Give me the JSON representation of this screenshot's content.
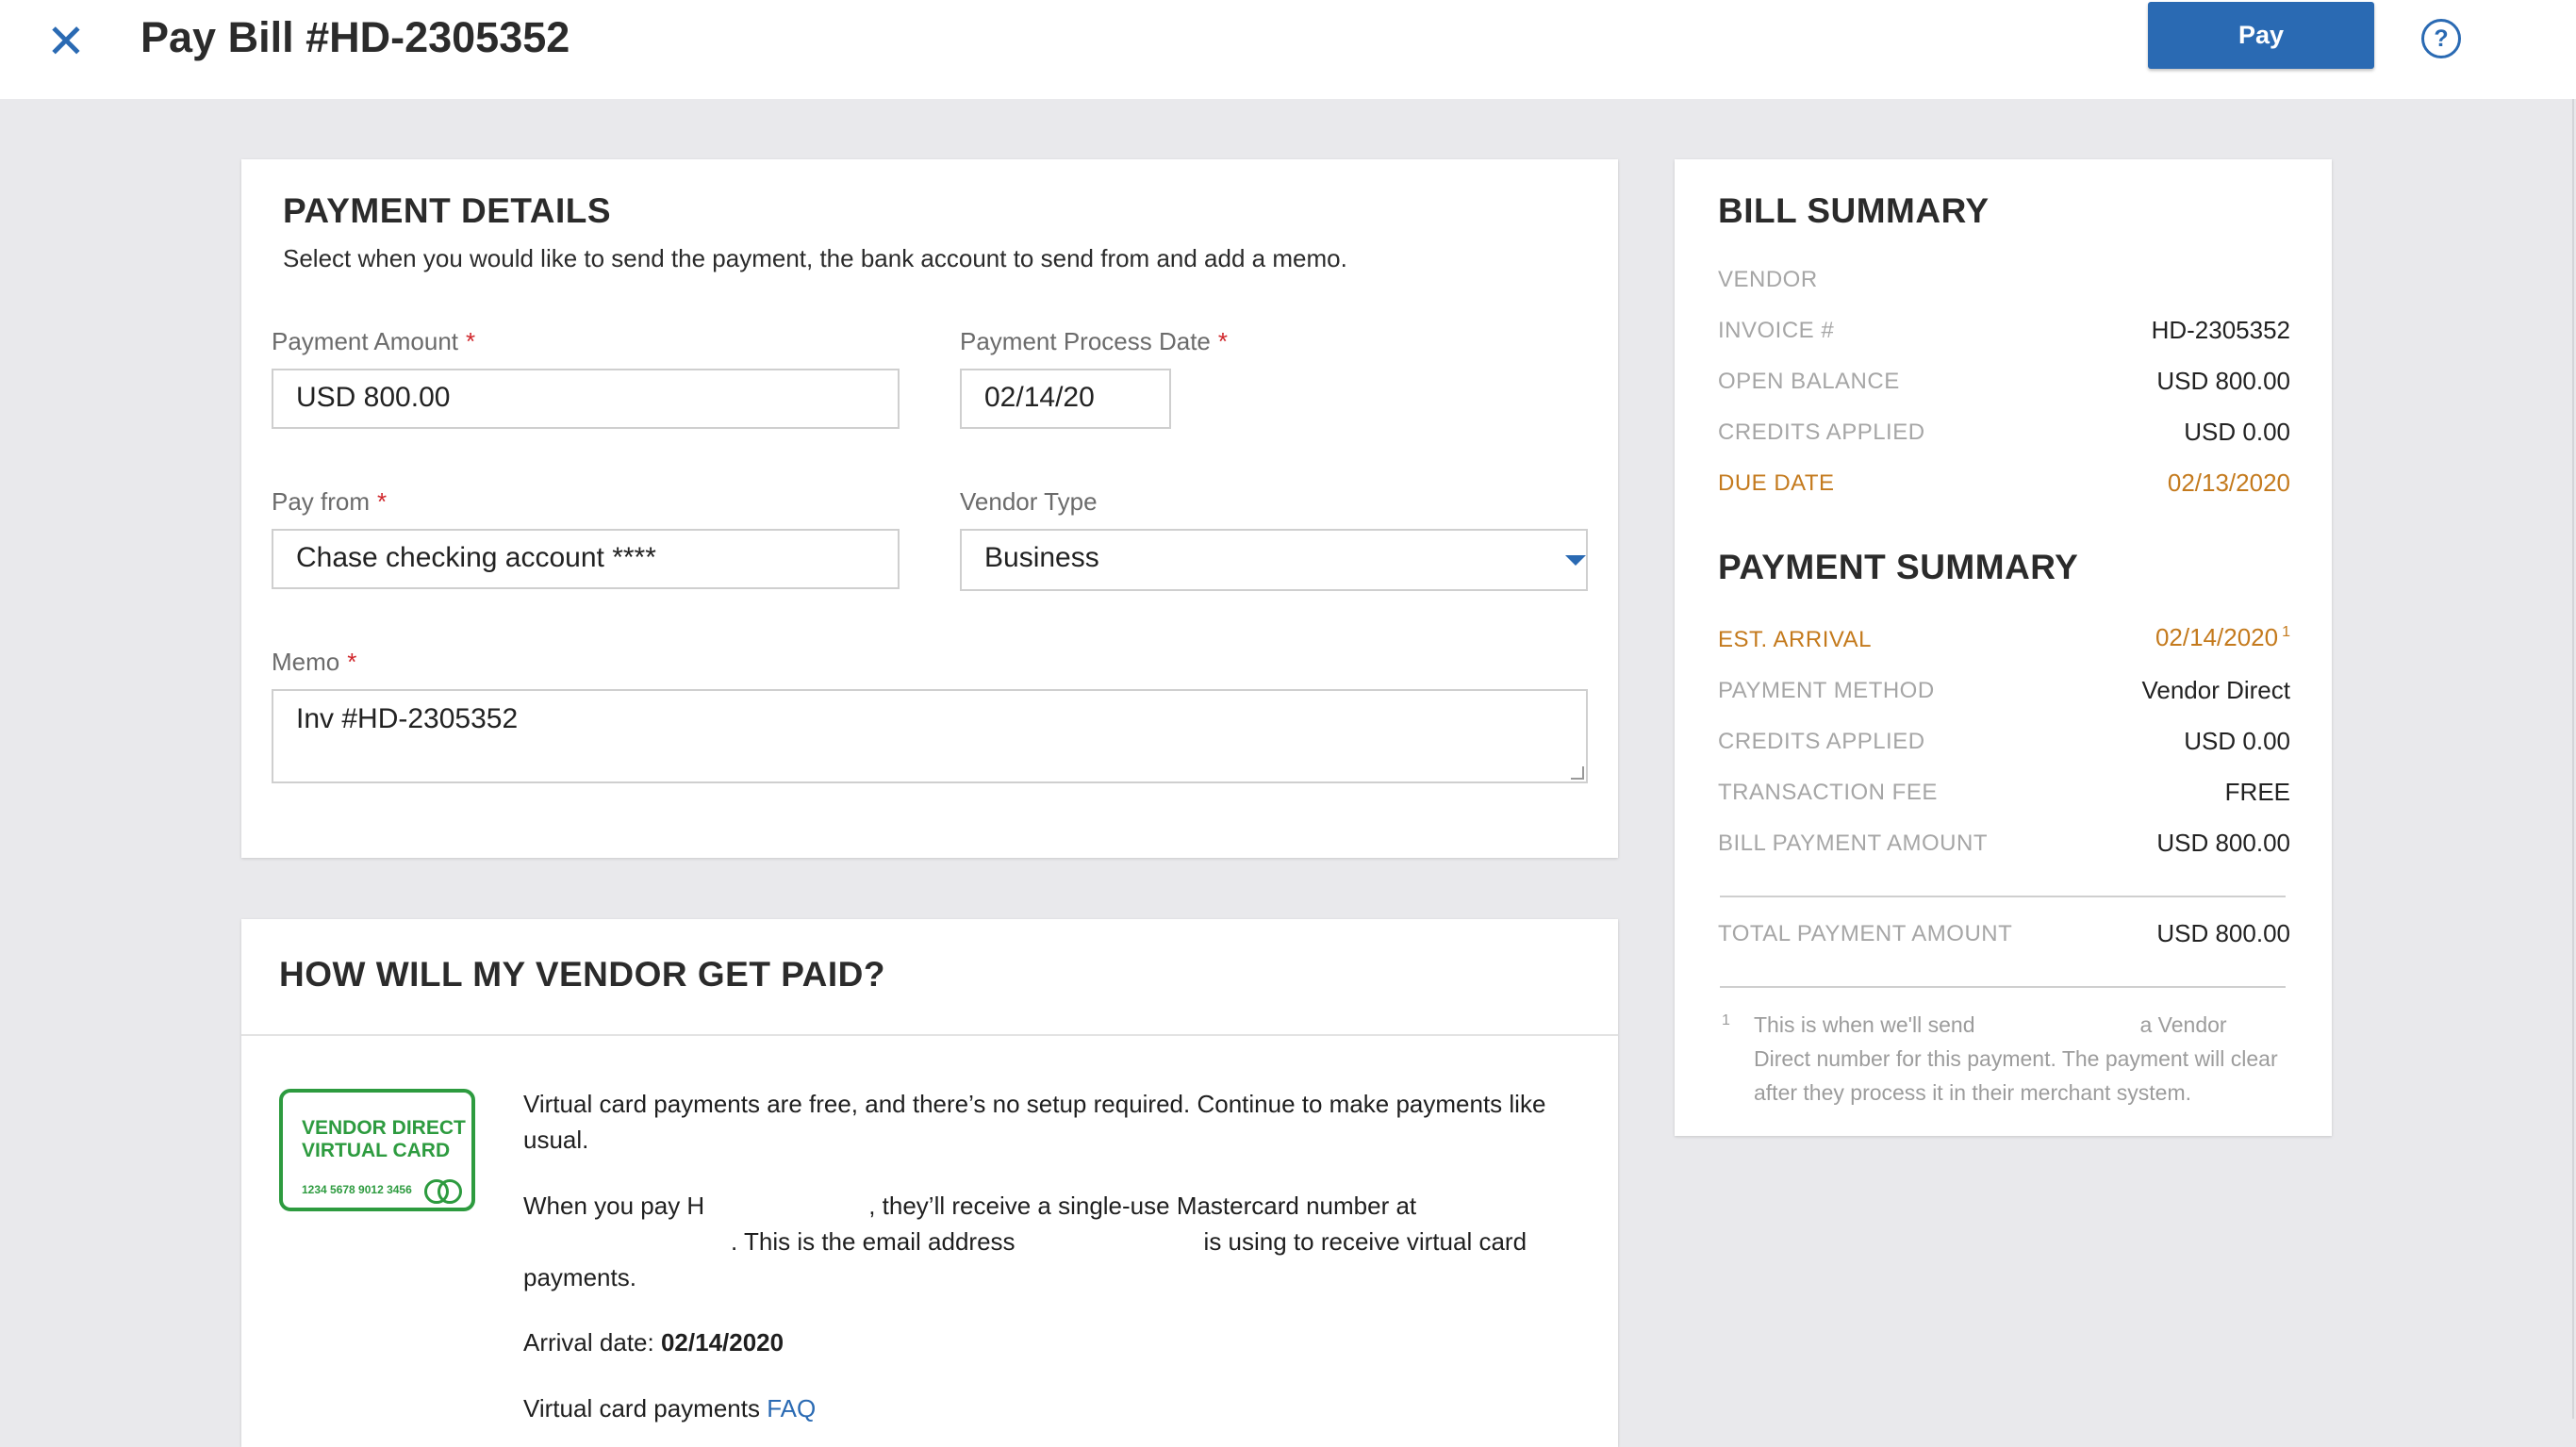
{
  "header": {
    "close_icon": "close-icon",
    "title": "Pay Bill #HD-2305352",
    "pay_label": "Pay",
    "help_glyph": "?"
  },
  "payment_details": {
    "title": "PAYMENT DETAILS",
    "subtitle": "Select when you would like to send the payment, the bank account to send from and add a memo.",
    "amount_label": "Payment Amount",
    "amount_value": "USD 800.00",
    "date_label": "Payment Process Date",
    "date_value": "02/14/20",
    "pay_from_label": "Pay from",
    "pay_from_value": "Chase checking account ****",
    "vendor_type_label": "Vendor Type",
    "vendor_type_value": "Business",
    "memo_label": "Memo",
    "memo_value": "Inv #HD-2305352",
    "required_mark": "*"
  },
  "how_paid": {
    "title": "HOW WILL MY VENDOR GET PAID?",
    "card_line1": "VENDOR DIRECT",
    "card_line2": "VIRTUAL CARD",
    "card_number": "1234 5678 9012 3456",
    "para1_line1": "Virtual card payments are free, and there’s no setup required. Continue to make payments like",
    "para1_line2": "usual.",
    "para2_a": "When you pay H",
    "para2_b": ", they’ll receive a single-use Mastercard number at",
    "para2_c": ". This is the email address",
    "para2_d": "is using to receive virtual card",
    "para2_e": "payments.",
    "arrival_label": "Arrival date:",
    "arrival_value": "02/14/2020",
    "faq_prefix": "Virtual card payments",
    "faq_link": "FAQ"
  },
  "bill_summary": {
    "title": "BILL SUMMARY",
    "rows": [
      {
        "label": "VENDOR",
        "value": ""
      },
      {
        "label": "INVOICE #",
        "value": "HD-2305352"
      },
      {
        "label": "OPEN BALANCE",
        "value": "USD 800.00"
      },
      {
        "label": "CREDITS APPLIED",
        "value": "USD 0.00"
      },
      {
        "label": "DUE DATE",
        "value": "02/13/2020"
      }
    ]
  },
  "payment_summary": {
    "title": "PAYMENT SUMMARY",
    "rows": [
      {
        "label": "EST. ARRIVAL",
        "value": "02/14/2020",
        "sup": "1"
      },
      {
        "label": "PAYMENT METHOD",
        "value": "Vendor Direct"
      },
      {
        "label": "CREDITS APPLIED",
        "value": "USD 0.00"
      },
      {
        "label": "TRANSACTION FEE",
        "value": "FREE"
      },
      {
        "label": "BILL PAYMENT AMOUNT",
        "value": "USD 800.00"
      }
    ],
    "total_label": "TOTAL PAYMENT AMOUNT",
    "total_value": "USD 800.00",
    "footnote_mark": "1",
    "footnote_line1a": "This is when we'll send",
    "footnote_line1b": "a Vendor",
    "footnote_line2": "Direct number for this payment. The payment will clear",
    "footnote_line3": "after they process it in their merchant system."
  },
  "colors": {
    "accent": "#2a6ab3",
    "required": "#d0262b",
    "due": "#c47a1d",
    "virtual_card": "#2d9b3f"
  }
}
